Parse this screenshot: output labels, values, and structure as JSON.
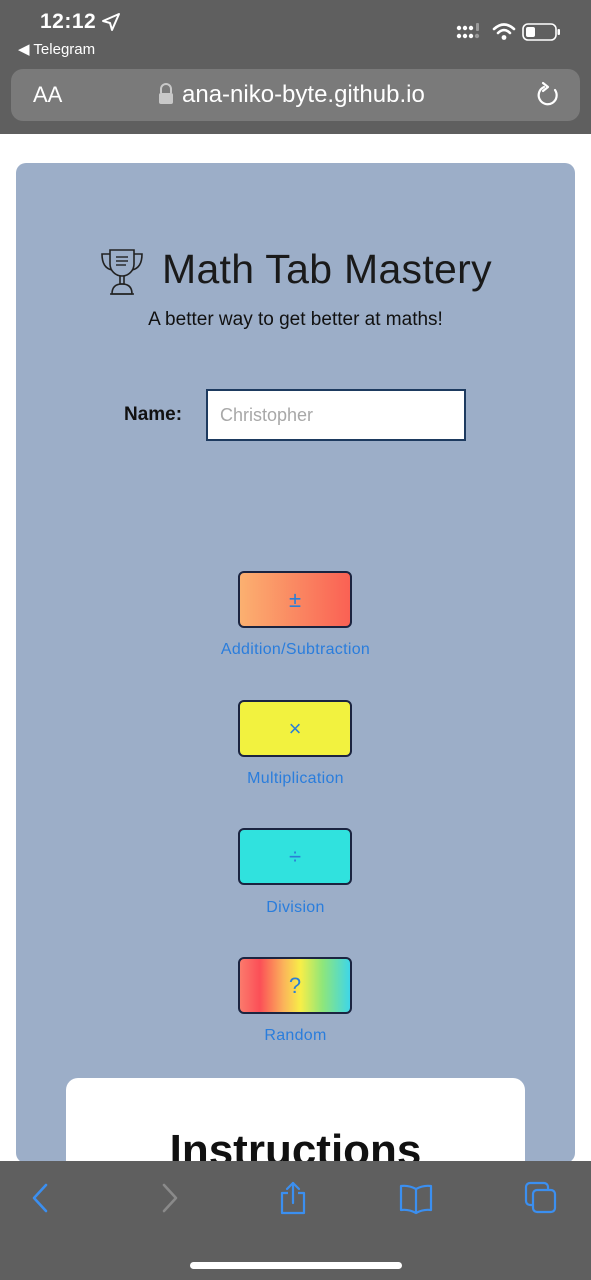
{
  "status_bar": {
    "time": "12:12",
    "back_app": "◀ Telegram"
  },
  "browser": {
    "aa_label": "AA",
    "url": "ana-niko-byte.github.io"
  },
  "page": {
    "title": "Math Tab Mastery",
    "subtitle": "A better way to get better at maths!",
    "name_label": "Name:",
    "name_placeholder": "Christopher",
    "operations": [
      {
        "symbol": "±",
        "label": "Addition/Subtraction"
      },
      {
        "symbol": "×",
        "label": "Multiplication"
      },
      {
        "symbol": "÷",
        "label": "Division"
      },
      {
        "symbol": "?",
        "label": "Random"
      }
    ],
    "instructions_title": "Instructions"
  },
  "colors": {
    "card_bg": "#9caec8",
    "link_blue": "#2a7ddc",
    "multiplication": "#f2f23f",
    "division": "#30e2de"
  },
  "icons": [
    "location-arrow-icon",
    "cellular-signal-icon",
    "wifi-icon",
    "battery-icon",
    "lock-icon",
    "reload-icon",
    "trophy-icon",
    "back-arrow-icon",
    "forward-arrow-icon",
    "share-icon",
    "bookmarks-icon",
    "tabs-icon"
  ]
}
